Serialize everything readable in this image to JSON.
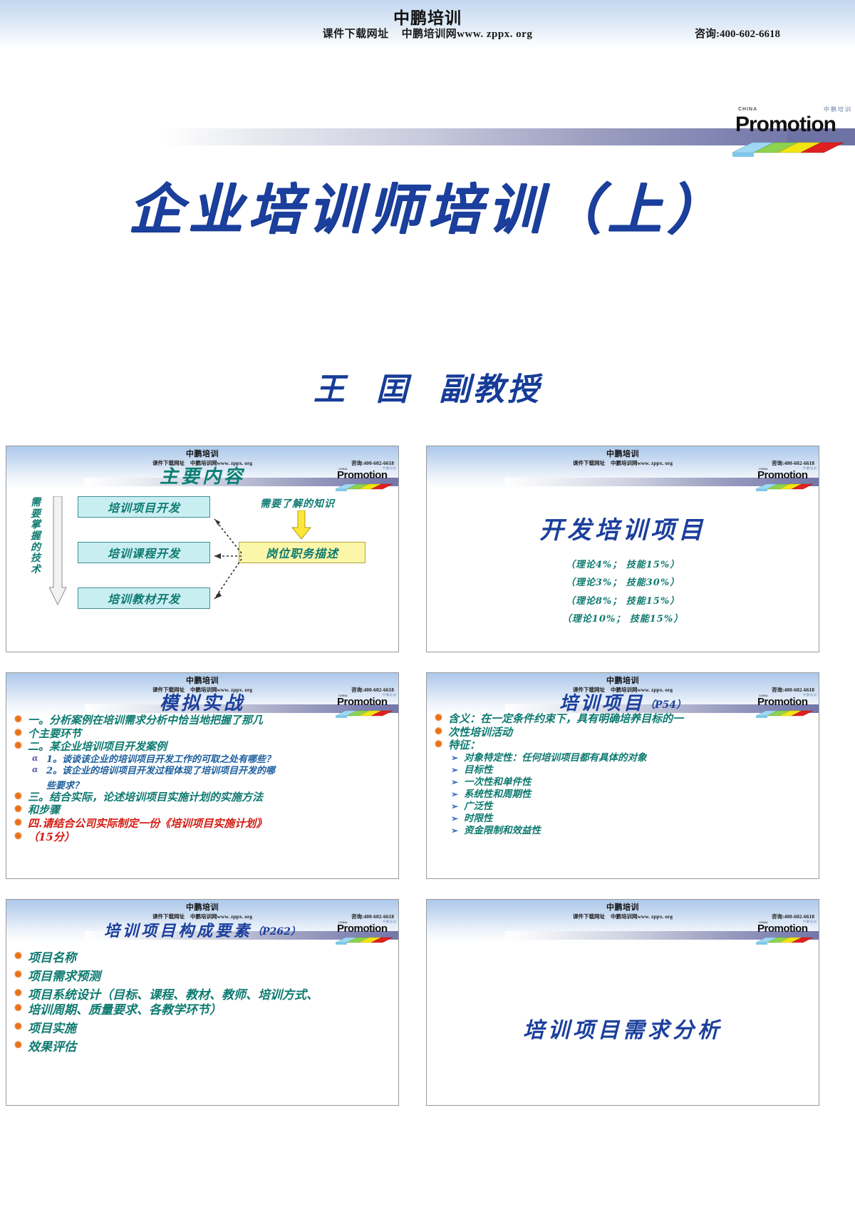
{
  "banner": {
    "brand": "中鹏培训",
    "download_label": "课件下载网址",
    "site": "中鹏培训网www. zppx. org",
    "phone": "咨询:400-602-6618"
  },
  "logo": {
    "word": "Promotion",
    "small_top": "CHINA",
    "cn_mark": "中鹏培训"
  },
  "title_slide": {
    "title": "企业培训师培训（上）",
    "author_name": "王",
    "author_given": "囯",
    "author_rank": "副教授"
  },
  "slides": [
    {
      "id": "slide-main-contents",
      "title": "主要内容",
      "title_color": "teal",
      "vertical_label": "需要掌握的技术",
      "boxes": [
        "培训项目开发",
        "培训课程开发",
        "培训教材开发"
      ],
      "knowledge_label": "需要了解的知识",
      "yellow_box": "岗位职务描述"
    },
    {
      "id": "slide-develop-training-project",
      "title": "开发培训项目",
      "title_color": "blue",
      "percent_lines": [
        "（理论4%； 技能15%）",
        "（理论3%； 技能30%）",
        "（理论8%； 技能15%）",
        "（理论10%； 技能15%）"
      ]
    },
    {
      "id": "slide-simulation-practice",
      "title": "模拟实战",
      "title_color": "blue",
      "bullets": [
        {
          "level": 1,
          "color": "teal",
          "text": "一。分析案例在培训需求分析中恰当地把握了那几"
        },
        {
          "level": 0,
          "color": "teal",
          "text": "个主要环节"
        },
        {
          "level": 1,
          "color": "teal",
          "text": "二。某企业培训项目开发案例"
        },
        {
          "level": 2,
          "color": "blue",
          "text": "1。谈谈该企业的培训项目开发工作的可取之处有哪些？"
        },
        {
          "level": 2,
          "color": "blue",
          "text": "2。该企业的培训项目开发过程体现了培训项目开发的哪"
        },
        {
          "level": 20,
          "color": "blue",
          "text": "些要求？"
        },
        {
          "level": 1,
          "color": "teal",
          "text": "三。结合实际，论述培训项目实施计划的实施方法"
        },
        {
          "level": 0,
          "color": "teal",
          "text": "和步骤"
        },
        {
          "level": 1,
          "color": "red",
          "text": "四.请结合公司实际制定一份《培训项目实施计划》"
        },
        {
          "level": 0,
          "color": "red",
          "text": "（15分）"
        }
      ]
    },
    {
      "id": "slide-training-project-p54",
      "title": "培训项目",
      "title_suffix": "（P54）",
      "title_color": "blue",
      "bullets": [
        {
          "level": 1,
          "color": "teal",
          "text": "含义：在一定条件约束下，具有明确培养目标的一"
        },
        {
          "level": 0,
          "color": "teal",
          "text": "次性培训活动"
        },
        {
          "level": 1,
          "color": "teal",
          "text": "特征："
        },
        {
          "level": 3,
          "color": "teal",
          "text": "对象特定性：任何培训项目都有具体的对象"
        },
        {
          "level": 3,
          "color": "teal",
          "text": "目标性"
        },
        {
          "level": 3,
          "color": "teal",
          "text": "一次性和单件性"
        },
        {
          "level": 3,
          "color": "teal",
          "text": "系统性和周期性"
        },
        {
          "level": 3,
          "color": "teal",
          "text": "广泛性"
        },
        {
          "level": 3,
          "color": "teal",
          "text": "时限性"
        },
        {
          "level": 3,
          "color": "teal",
          "text": "资金限制和效益性"
        }
      ]
    },
    {
      "id": "slide-project-elements-p262",
      "title": "培训项目构成要素",
      "title_suffix": "（P262）",
      "title_color": "blue",
      "bullets": [
        {
          "level": 1,
          "color": "teal",
          "text": "项目名称"
        },
        {
          "level": 1,
          "color": "teal",
          "text": "项目需求预测"
        },
        {
          "level": 1,
          "color": "teal",
          "text": "项目系统设计（目标、课程、教材、教师、培训方式、"
        },
        {
          "level": 0,
          "color": "teal",
          "text": "培训周期、质量要求、各教学环节）"
        },
        {
          "level": 1,
          "color": "teal",
          "text": "项目实施"
        },
        {
          "level": 1,
          "color": "teal",
          "text": "效果评估"
        }
      ]
    },
    {
      "id": "slide-training-demand-analysis",
      "title": "",
      "center_heading": "培训项目需求分析"
    }
  ]
}
